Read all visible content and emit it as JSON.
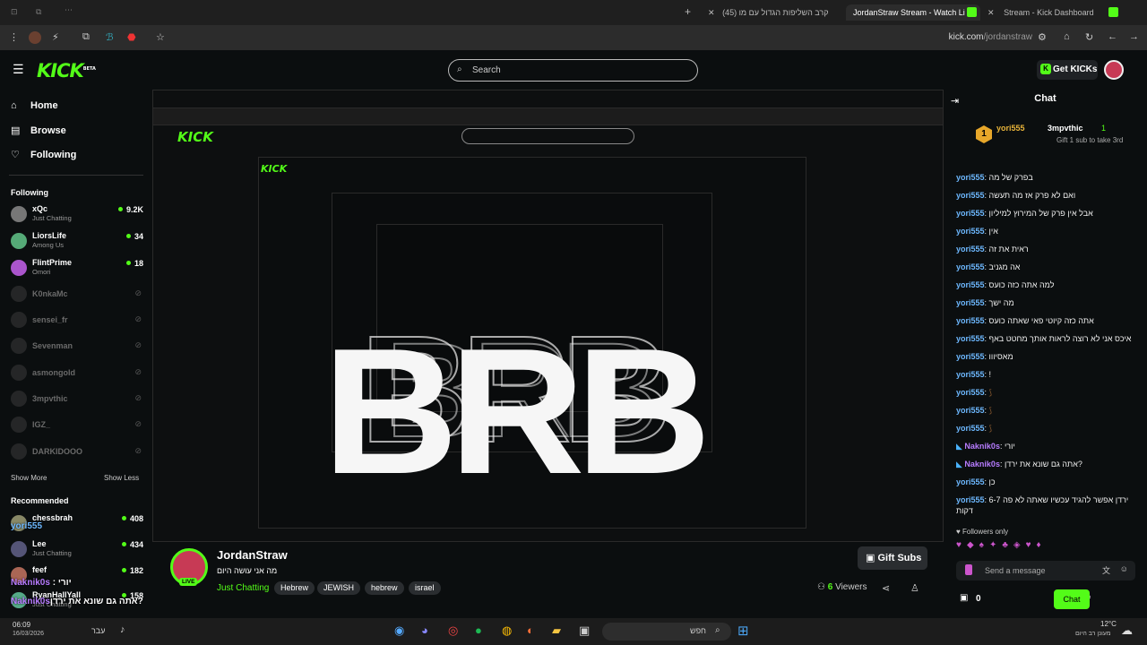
{
  "tabs": [
    {
      "label": "(45) קרב השליפות הגדול עם מו"
    },
    {
      "label": "JordanStraw Stream - Watch Li"
    },
    {
      "label": "Stream - Kick Dashboard"
    }
  ],
  "url": {
    "domain": "kick.com",
    "path": "/jordanstraw"
  },
  "header": {
    "logo": "KICK",
    "logo_sup": "BETA",
    "search_placeholder": "Search",
    "get_kicks": "Get KICKs"
  },
  "nav": [
    {
      "label": "Home",
      "icon": "home-icon"
    },
    {
      "label": "Browse",
      "icon": "browse-icon"
    },
    {
      "label": "Following",
      "icon": "heart-icon"
    }
  ],
  "following": {
    "title": "Following",
    "channels": [
      {
        "name": "xQc",
        "game": "Just Chatting",
        "viewers": "9.2K",
        "live": true
      },
      {
        "name": "LiorsLife",
        "game": "Among Us",
        "viewers": "34",
        "live": true
      },
      {
        "name": "FlintPrime",
        "game": "Omori",
        "viewers": "18",
        "live": true
      },
      {
        "name": "K0nkaMc",
        "live": false
      },
      {
        "name": "sensei_fr",
        "live": false
      },
      {
        "name": "Sevenman",
        "live": false
      },
      {
        "name": "asmongold",
        "live": false
      },
      {
        "name": "3mpvthic",
        "live": false
      },
      {
        "name": "IGZ_",
        "live": false
      },
      {
        "name": "DARKIDOOO",
        "live": false
      }
    ],
    "show_more": "Show More",
    "show_less": "Show Less"
  },
  "recommended": {
    "title": "Recommended",
    "channels": [
      {
        "name": "chessbrah",
        "game": "",
        "viewers": "408"
      },
      {
        "name": "Lee",
        "game": "Just Chatting",
        "viewers": "434"
      },
      {
        "name": "feef",
        "game": "",
        "viewers": "182"
      },
      {
        "name": "RyanHallYall",
        "game": "Just Chatting",
        "viewers": "158"
      }
    ]
  },
  "stream": {
    "overlay": "BRB"
  },
  "info": {
    "streamer": "JordanStraw",
    "title": "מה אני עושה היום",
    "category": "Just Chatting",
    "live": "LIVE",
    "tags": [
      "Hebrew",
      "JEWISH",
      "hebrew",
      "israel"
    ],
    "gift_subs": "Gift Subs",
    "viewers": "6",
    "viewers_label": "Viewers"
  },
  "chat": {
    "title": "Chat",
    "pinned": {
      "rank": "1",
      "user": "yori555",
      "gifter": "3mpvthic",
      "count": "1",
      "text": "Gift 1 sub to take 3rd"
    },
    "messages": [
      {
        "user": "yori555",
        "text": "בפרק של מה"
      },
      {
        "user": "yori555",
        "text": "ואם לא פרק אז מה תעשה"
      },
      {
        "user": "yori555",
        "text": "אבל אין פרק של המירוץ למיליון"
      },
      {
        "user": "yori555",
        "text": "אין"
      },
      {
        "user": "yori555",
        "text": "ראית את זה"
      },
      {
        "user": "yori555",
        "text": "אה מגניב"
      },
      {
        "user": "yori555",
        "text": "למה אתה כזה כועס"
      },
      {
        "user": "yori555",
        "text": "מה ישך"
      },
      {
        "user": "yori555",
        "text": "אתה כזה קיוטי פאי שאתה כועס"
      },
      {
        "user": "yori555",
        "text": "איכס אני לא רוצה לראות אותך מחטט באף"
      },
      {
        "user": "yori555",
        "text": "מאסיווו"
      },
      {
        "user": "yori555",
        "text": "!"
      },
      {
        "user": "yori555",
        "text": ""
      },
      {
        "user": "yori555",
        "text": ""
      },
      {
        "user": "yori555",
        "text": ""
      },
      {
        "user": "Naknik0s",
        "text": "יורי"
      },
      {
        "user": "Naknik0s",
        "text": "אתה גם שונא את ירדן?"
      },
      {
        "user": "yori555",
        "text": "כן"
      },
      {
        "user": "yori555",
        "text": "ירדן אפשר להגיד עכשיו שאתה לא פה 6-7 דקות"
      }
    ],
    "followers_only": "Followers only",
    "input_placeholder": "Send a message",
    "count": "0",
    "send": "Chat"
  },
  "taskbar": {
    "temp": "12°C",
    "weather": "מעונן רב היום",
    "search": "חפש",
    "date": "16/03/2026",
    "time": "06:09",
    "lang": "עבר"
  }
}
